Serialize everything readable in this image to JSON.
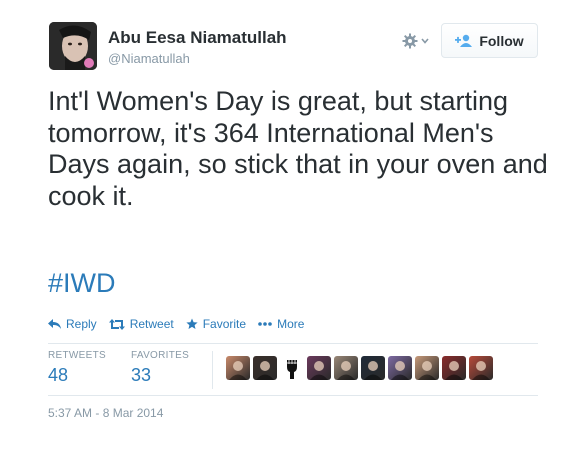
{
  "author": {
    "display_name": "Abu Eesa Niamatullah",
    "username": "@Niamatullah",
    "avatar_icon": "user-avatar"
  },
  "header": {
    "gear_icon": "gear-icon",
    "follow_label": "Follow",
    "follow_icon": "add-user-icon"
  },
  "tweet": {
    "text": "Int'l Women's Day is great, but starting tomorrow, it's 364 International Men's Days again, so stick that in your oven and cook it.",
    "hashtag": "#IWD"
  },
  "actions": {
    "reply": "Reply",
    "retweet": "Retweet",
    "favorite": "Favorite",
    "more": "More"
  },
  "stats": {
    "retweets_label": "RETWEETS",
    "retweets_value": "48",
    "favorites_label": "FAVORITES",
    "favorites_value": "33"
  },
  "favoriters": [
    {
      "icon": "favoriter-avatar-1",
      "color": "#c98a6b"
    },
    {
      "icon": "favoriter-avatar-2",
      "color": "#3a2f2a"
    },
    {
      "icon": "raised-fist-icon",
      "color": "#111111"
    },
    {
      "icon": "favoriter-avatar-4",
      "color": "#6b3a5c"
    },
    {
      "icon": "favoriter-avatar-5",
      "color": "#9a8878"
    },
    {
      "icon": "favoriter-avatar-6",
      "color": "#1f2a38"
    },
    {
      "icon": "favoriter-avatar-7",
      "color": "#7e6aa3"
    },
    {
      "icon": "favoriter-avatar-8",
      "color": "#c79a7a"
    },
    {
      "icon": "favoriter-avatar-9",
      "color": "#8a2b2b"
    },
    {
      "icon": "favoriter-avatar-10",
      "color": "#b84a3a"
    }
  ],
  "timestamp": "5:37 AM - 8 Mar 2014",
  "colors": {
    "link": "#2b7bb9",
    "text": "#292f33",
    "muted": "#8899a6",
    "border": "#e1e8ed"
  }
}
